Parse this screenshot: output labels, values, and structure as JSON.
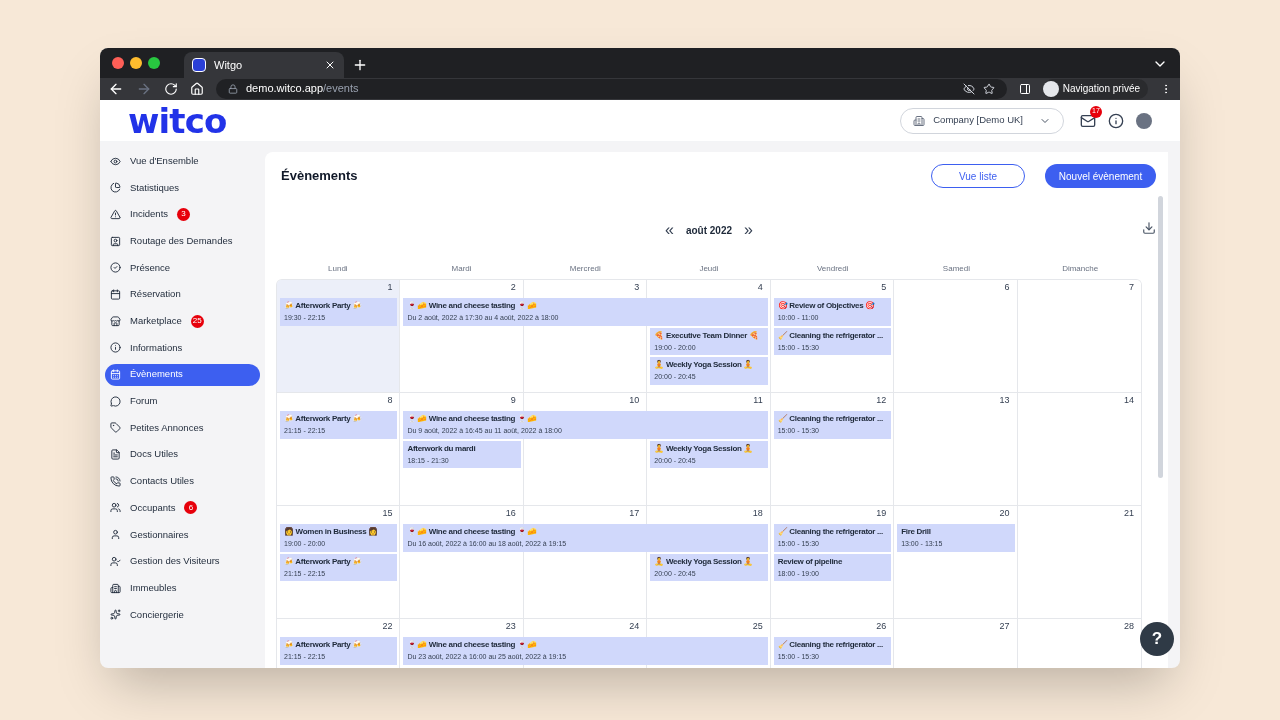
{
  "browser": {
    "tab_title": "Witgo",
    "url_host": "demo.witco.app",
    "url_path": "/events",
    "profile": "Navigation privée"
  },
  "header": {
    "logo": "witco",
    "company": "Company [Demo UK]",
    "mail_badge": "17"
  },
  "sidebar": {
    "items": [
      {
        "label": "Vue d'Ensemble",
        "selected": false
      },
      {
        "label": "Statistiques",
        "selected": false
      },
      {
        "label": "Incidents",
        "selected": false,
        "badge": "3"
      },
      {
        "label": "Routage des Demandes",
        "selected": false
      },
      {
        "label": "Présence",
        "selected": false
      },
      {
        "label": "Réservation",
        "selected": false
      },
      {
        "label": "Marketplace",
        "selected": false,
        "badge": "25"
      },
      {
        "label": "Informations",
        "selected": false
      },
      {
        "label": "Évènements",
        "selected": true
      },
      {
        "label": "Forum",
        "selected": false
      },
      {
        "label": "Petites Annonces",
        "selected": false
      },
      {
        "label": "Docs Utiles",
        "selected": false
      },
      {
        "label": "Contacts Utiles",
        "selected": false
      },
      {
        "label": "Occupants",
        "selected": false,
        "badge": "6"
      },
      {
        "label": "Gestionnaires",
        "selected": false
      },
      {
        "label": "Gestion des Visiteurs",
        "selected": false
      },
      {
        "label": "Immeubles",
        "selected": false
      },
      {
        "label": "Conciergerie",
        "selected": false
      }
    ]
  },
  "page": {
    "title": "Évènements",
    "list_button": "Vue liste",
    "new_button": "Nouvel évènement",
    "month": "août 2022",
    "prev": "«",
    "next": "»"
  },
  "calendar": {
    "weekdays": [
      "Lundi",
      "Mardi",
      "Mercredi",
      "Jeudi",
      "Vendredi",
      "Samedi",
      "Dimanche"
    ],
    "weeks": [
      {
        "days": [
          {
            "number": "1",
            "selected": true,
            "events": [
              {
                "title": "🍻 Afterwork Party 🍻",
                "time": "19:30 - 22:15"
              }
            ]
          },
          {
            "number": "2",
            "selected": false,
            "events": [
              {
                "title": "🍷🧀 Wine and cheese tasting 🍷🧀",
                "time": "Du 2 août, 2022 à 17:30 au 4 août, 2022 à 18:00"
              }
            ]
          },
          {
            "number": "3",
            "selected": false,
            "covered": true
          },
          {
            "number": "4",
            "selected": false,
            "covered": true,
            "events": [
              {
                "title": "🍕 Executive Team Dinner 🍕",
                "time": "19:00 - 20:00"
              },
              {
                "title": "🧘 Weekly Yoga Session 🧘",
                "time": "20:00 - 20:45"
              }
            ]
          },
          {
            "number": "5",
            "selected": false,
            "events": [
              {
                "title": "🎯 Review of Objectives 🎯",
                "time": "10:00 - 11:00"
              },
              {
                "title": "🧹 Cleaning the refrigerator ...",
                "time": "15:00 - 15:30"
              }
            ]
          },
          {
            "number": "6",
            "selected": false
          },
          {
            "number": "7",
            "selected": false
          }
        ]
      },
      {
        "days": [
          {
            "number": "8",
            "selected": false,
            "events": [
              {
                "title": "🍻 Afterwork Party 🍻",
                "time": "21:15 - 22:15"
              }
            ]
          },
          {
            "number": "9",
            "selected": false,
            "events": [
              {
                "title": "🍷🧀 Wine and cheese tasting 🍷🧀",
                "time": "Du 9 août, 2022 à 16:45 au 11 août, 2022 à 18:00"
              },
              {
                "title": "Afterwork du mardi",
                "time": "18:15 - 21:30"
              }
            ]
          },
          {
            "number": "10",
            "selected": false,
            "covered": true
          },
          {
            "number": "11",
            "selected": false,
            "covered": true,
            "events": [
              {
                "title": "🧘 Weekly Yoga Session 🧘",
                "time": "20:00 - 20:45"
              }
            ]
          },
          {
            "number": "12",
            "selected": false,
            "events": [
              {
                "title": "🧹 Cleaning the refrigerator ...",
                "time": "15:00 - 15:30"
              }
            ]
          },
          {
            "number": "13",
            "selected": false
          },
          {
            "number": "14",
            "selected": false
          }
        ]
      },
      {
        "days": [
          {
            "number": "15",
            "selected": false,
            "events": [
              {
                "title": "👩 Women in Business 👩",
                "time": "19:00 - 20:00"
              },
              {
                "title": "🍻 Afterwork Party 🍻",
                "time": "21:15 - 22:15"
              }
            ]
          },
          {
            "number": "16",
            "selected": false,
            "events": [
              {
                "title": "🍷🧀 Wine and cheese tasting 🍷🧀",
                "time": "Du 16 août, 2022 à 16:00 au 18 août, 2022 à 19:15"
              }
            ]
          },
          {
            "number": "17",
            "selected": false,
            "covered": true
          },
          {
            "number": "18",
            "selected": false,
            "covered": true,
            "events": [
              {
                "title": "🧘 Weekly Yoga Session 🧘",
                "time": "20:00 - 20:45"
              }
            ]
          },
          {
            "number": "19",
            "selected": false,
            "events": [
              {
                "title": "🧹 Cleaning the refrigerator ...",
                "time": "15:00 - 15:30"
              },
              {
                "title": "Review of pipeline",
                "time": "18:00 - 19:00"
              }
            ]
          },
          {
            "number": "20",
            "selected": false,
            "events": [
              {
                "title": "Fire Drill",
                "time": "13:00 - 13:15"
              }
            ]
          },
          {
            "number": "21",
            "selected": false
          }
        ]
      },
      {
        "days": [
          {
            "number": "22",
            "selected": false,
            "events": [
              {
                "title": "🍻 Afterwork Party 🍻",
                "time": "21:15 - 22:15"
              }
            ]
          },
          {
            "number": "23",
            "selected": false,
            "events": [
              {
                "title": "🍷🧀 Wine and cheese tasting 🍷🧀",
                "time": "Du 23 août, 2022 à 16:00 au 25 août, 2022 à 19:15"
              }
            ]
          },
          {
            "number": "24",
            "selected": false,
            "covered": true
          },
          {
            "number": "25",
            "selected": false,
            "covered": true
          },
          {
            "number": "26",
            "selected": false,
            "events": [
              {
                "title": "🧹 Cleaning the refrigerator ...",
                "time": "15:00 - 15:30"
              }
            ]
          },
          {
            "number": "27",
            "selected": false
          },
          {
            "number": "28",
            "selected": false
          }
        ]
      }
    ]
  },
  "help_button": "?"
}
